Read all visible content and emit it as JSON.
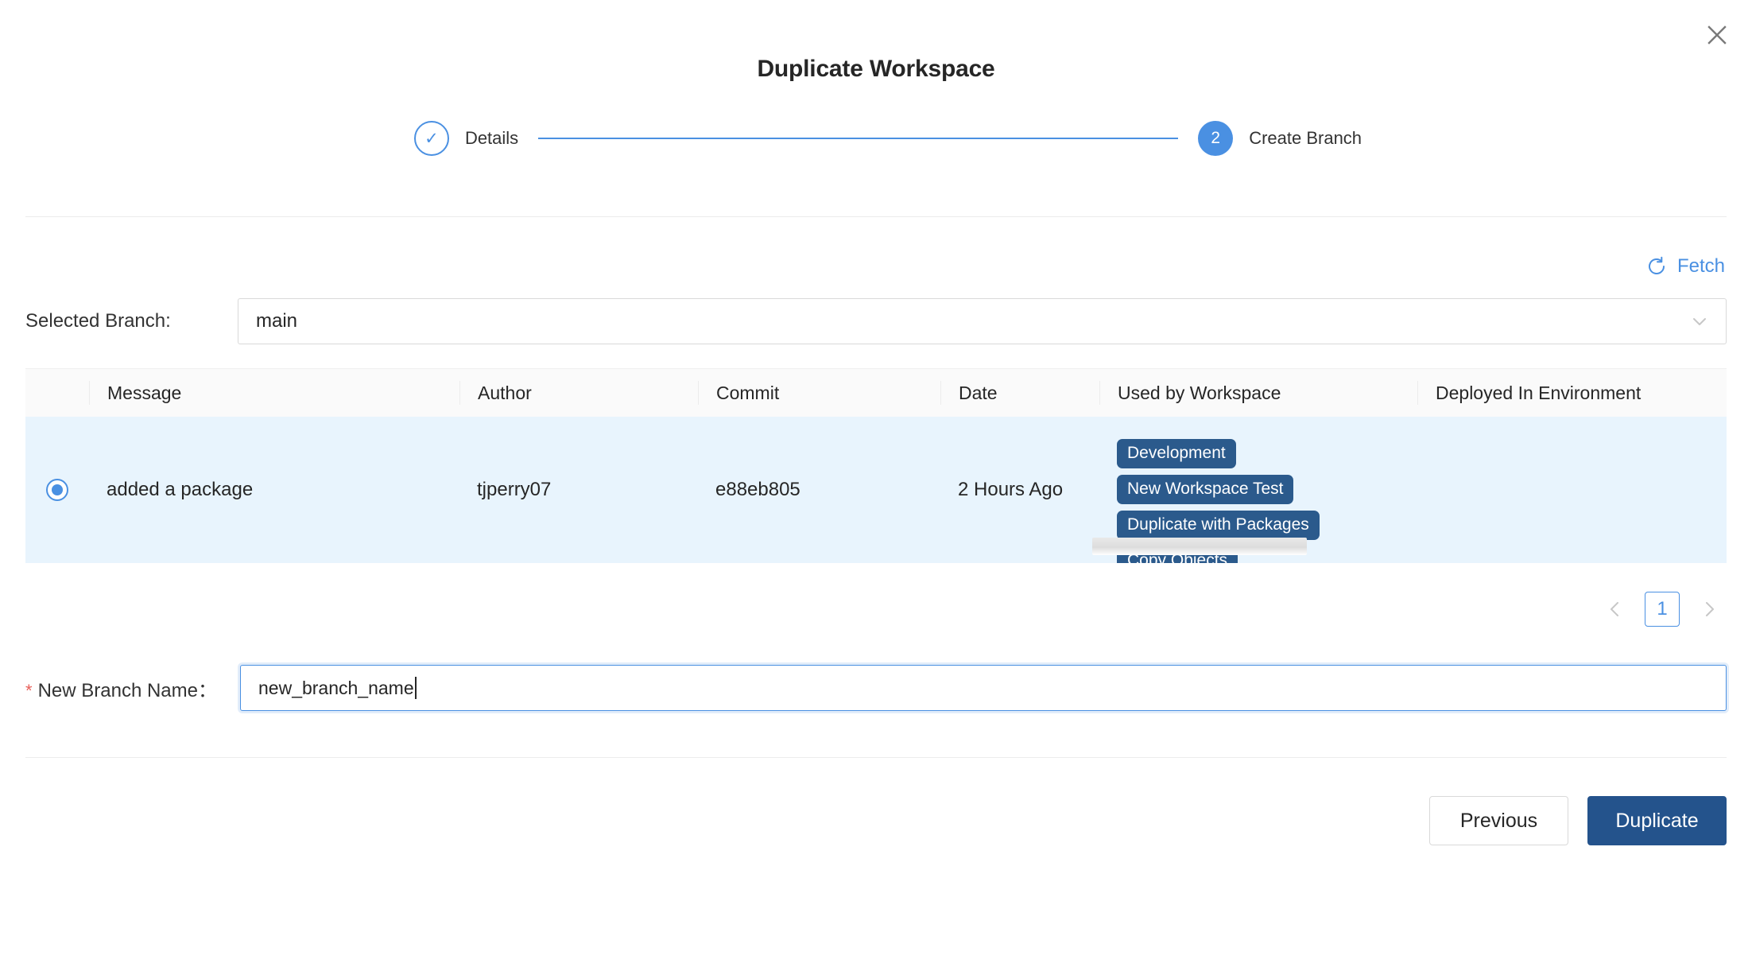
{
  "modal": {
    "title": "Duplicate Workspace",
    "close_icon": "close-icon"
  },
  "stepper": {
    "steps": [
      {
        "label": "Details",
        "marker": "✓",
        "state": "done"
      },
      {
        "label": "Create Branch",
        "marker": "2",
        "state": "current"
      }
    ]
  },
  "toolbar": {
    "fetch_label": "Fetch",
    "fetch_icon": "refresh-icon"
  },
  "branch": {
    "label": "Selected Branch:",
    "value": "main",
    "chevron_icon": "chevron-down-icon"
  },
  "table": {
    "columns": [
      "Message",
      "Author",
      "Commit",
      "Date",
      "Used by Workspace",
      "Deployed In Environment"
    ],
    "rows": [
      {
        "selected": true,
        "message": "added a package",
        "author": "tjperry07",
        "commit": "e88eb805",
        "date": "2 Hours Ago",
        "used_by_workspace": [
          "Development",
          "New Workspace Test",
          "Duplicate with Packages",
          "Copy Objects"
        ],
        "deployed_in_environment": ""
      }
    ]
  },
  "pagination": {
    "prev_icon": "chevron-left-icon",
    "next_icon": "chevron-right-icon",
    "current_page": "1"
  },
  "new_branch": {
    "required_marker": "*",
    "label": "New Branch Name：",
    "value": "new_branch_name",
    "placeholder": ""
  },
  "footer": {
    "previous_label": "Previous",
    "duplicate_label": "Duplicate"
  },
  "colors": {
    "accent_blue": "#4a90e2",
    "primary_button": "#24538c",
    "tag": "#2b5a8c",
    "row_selected": "#e8f4fd",
    "required_star": "#e8605a"
  }
}
